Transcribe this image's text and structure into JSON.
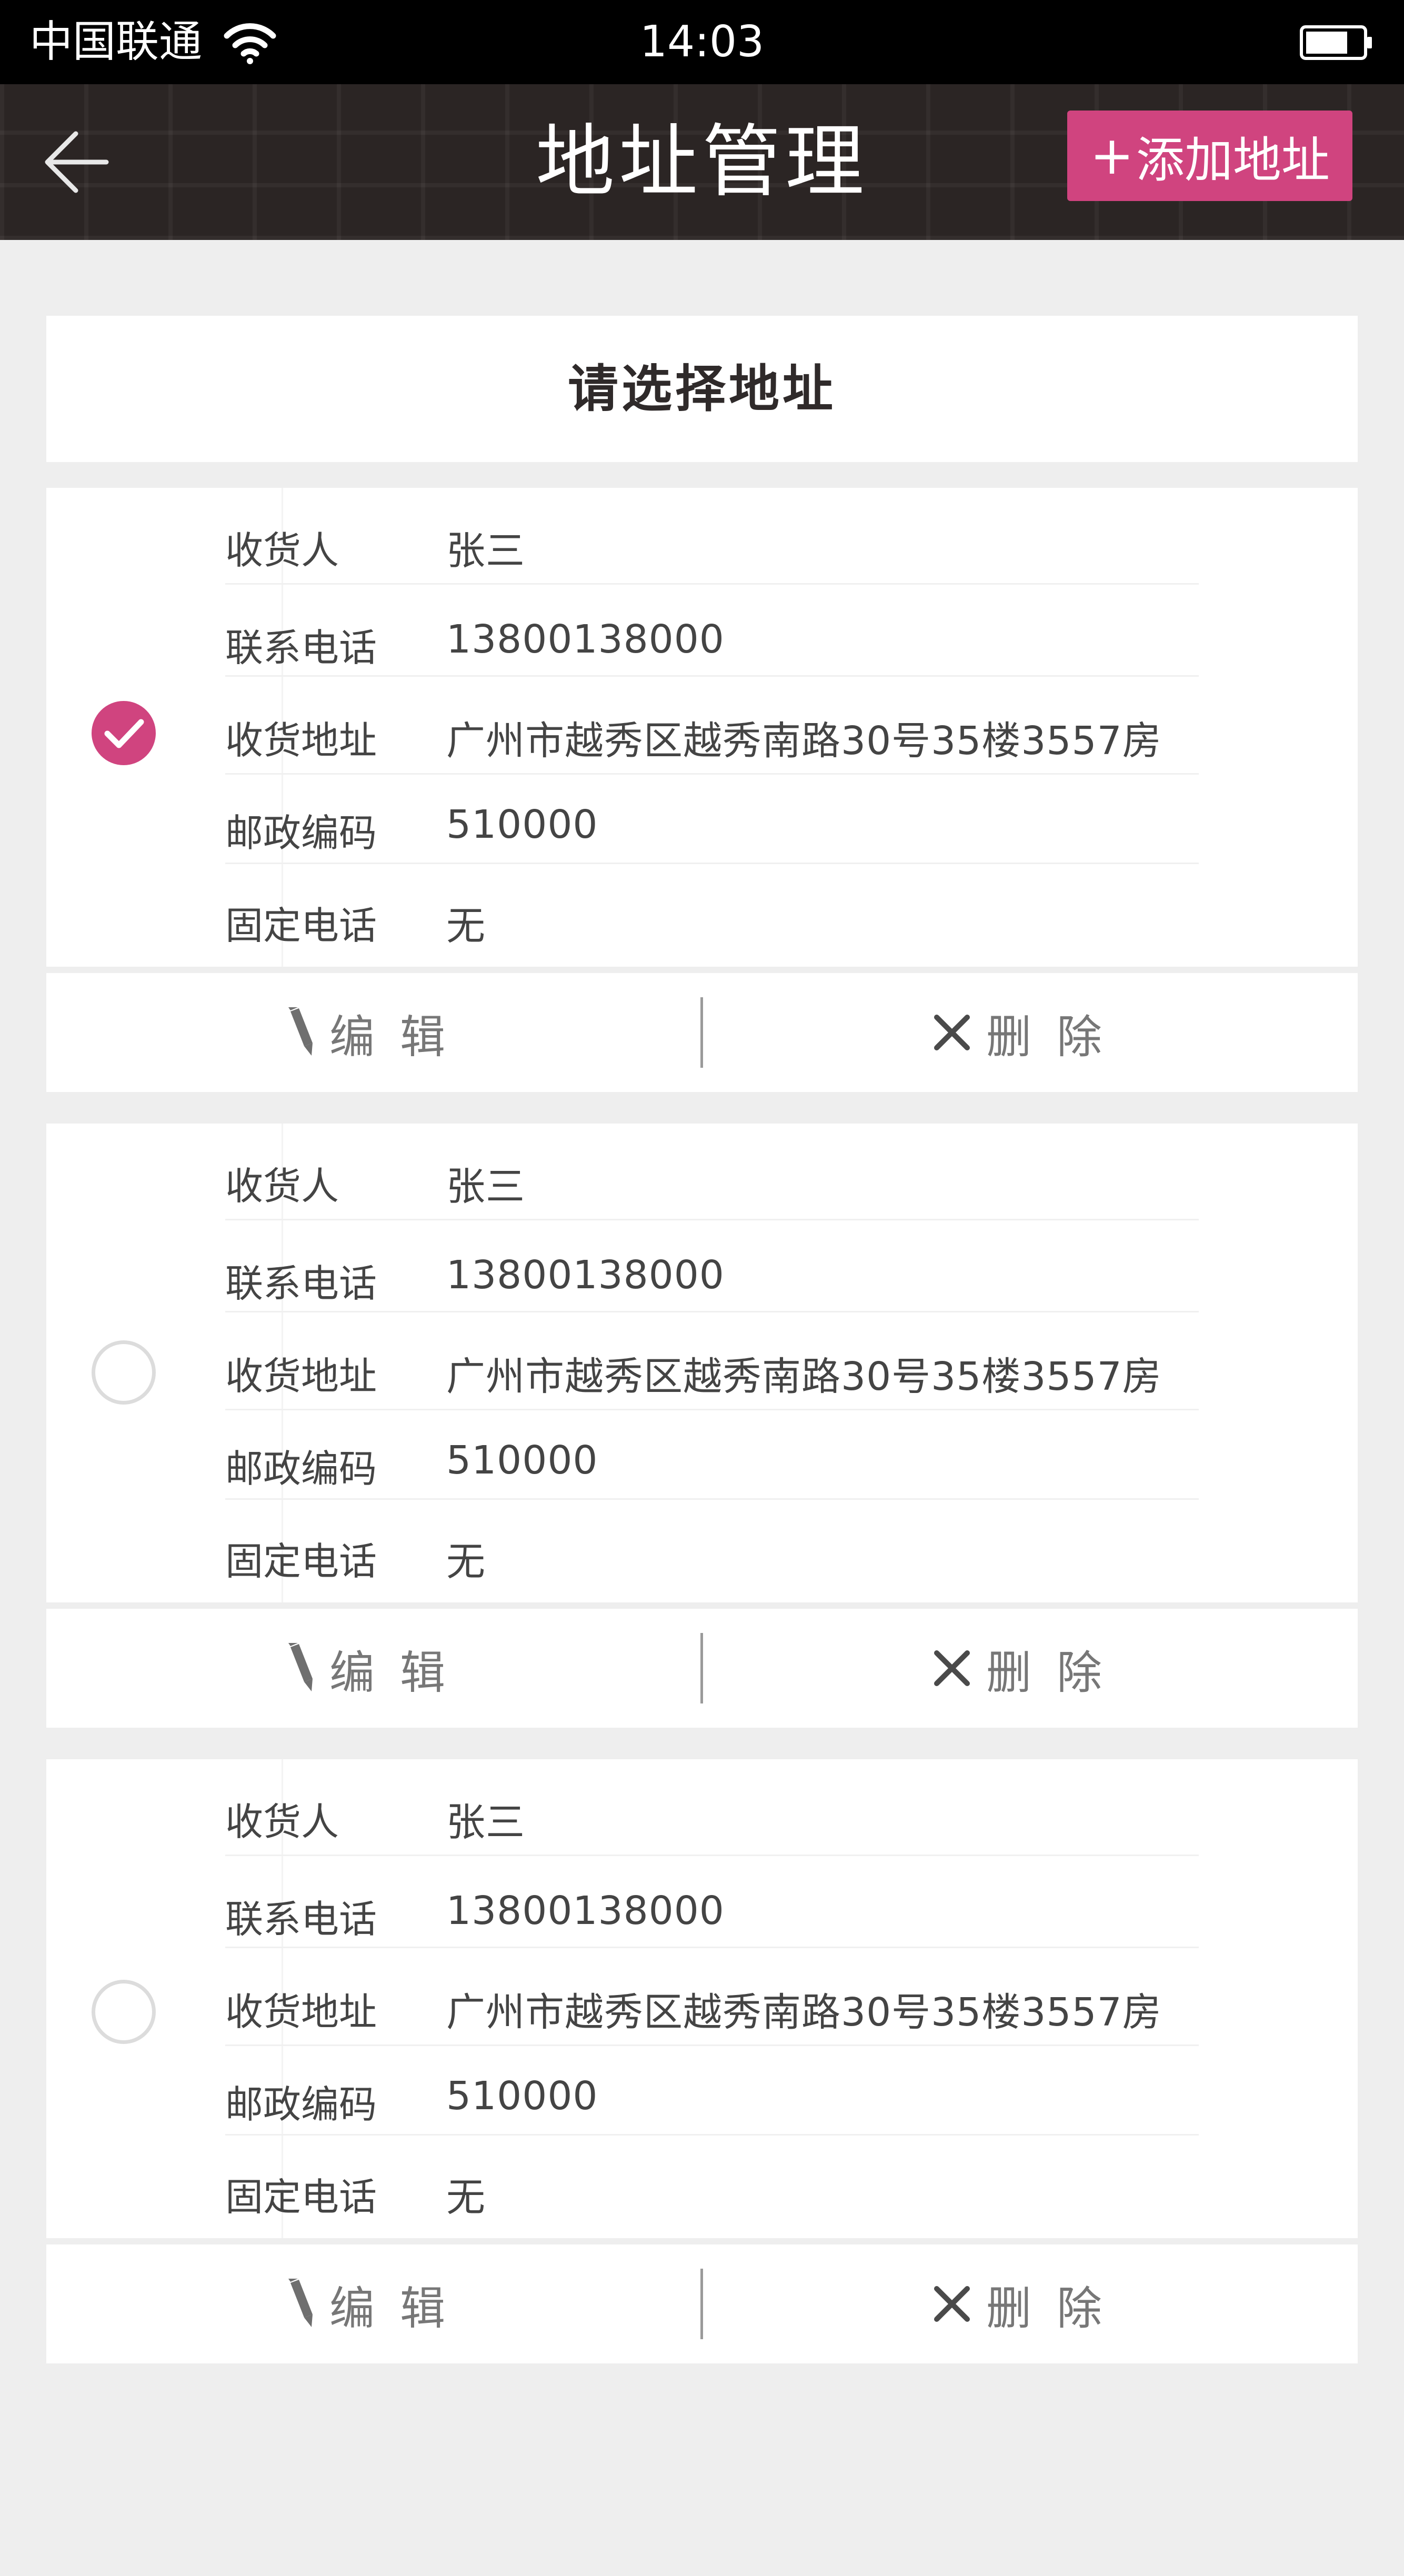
{
  "status_bar": {
    "carrier": "中国联通",
    "time": "14:03",
    "wifi_icon": "wifi-icon",
    "battery_icon": "battery-icon"
  },
  "nav": {
    "title": "地址管理",
    "add_button_label": "添加地址",
    "add_button_icon": "plus-icon",
    "back_icon": "back-arrow-icon"
  },
  "section_title": "请选择地址",
  "colors": {
    "accent": "#d0447f",
    "nav_bg": "#2b2524",
    "page_bg": "#eeeeee"
  },
  "field_labels": {
    "recipient": "收货人",
    "phone": "联系电话",
    "address": "收货地址",
    "postcode": "邮政编码",
    "landline": "固定电话"
  },
  "actions": {
    "edit": "编辑",
    "delete": "删除",
    "edit_icon": "pencil-icon",
    "delete_icon": "close-icon"
  },
  "addresses": [
    {
      "selected": true,
      "recipient": "张三",
      "phone": "13800138000",
      "address": "广州市越秀区越秀南路30号35楼3557房",
      "postcode": "510000",
      "landline": "无"
    },
    {
      "selected": false,
      "recipient": "张三",
      "phone": "13800138000",
      "address": "广州市越秀区越秀南路30号35楼3557房",
      "postcode": "510000",
      "landline": "无"
    },
    {
      "selected": false,
      "recipient": "张三",
      "phone": "13800138000",
      "address": "广州市越秀区越秀南路30号35楼3557房",
      "postcode": "510000",
      "landline": "无"
    }
  ]
}
